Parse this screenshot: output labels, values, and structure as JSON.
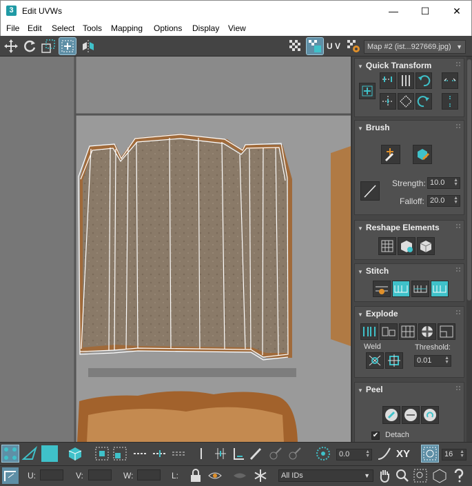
{
  "window": {
    "app_icon_label": "3",
    "title": "Edit UVWs",
    "minimize": "—",
    "maximize": "☐",
    "close": "✕"
  },
  "menu": [
    "File",
    "Edit",
    "Select",
    "Tools",
    "Mapping",
    "Options",
    "Display",
    "View"
  ],
  "toolbar": {
    "uv_label": "U V",
    "map_select": "Map #2 (ist...927669.jpg)"
  },
  "quick_transform": {
    "title": "Quick Transform"
  },
  "brush": {
    "title": "Brush",
    "strength_label": "Strength:",
    "strength_value": "10.0",
    "falloff_label": "Falloff:",
    "falloff_value": "20.0"
  },
  "reshape": {
    "title": "Reshape Elements"
  },
  "stitch": {
    "title": "Stitch"
  },
  "explode": {
    "title": "Explode",
    "weld_label": "Weld",
    "threshold_label": "Threshold:",
    "threshold_value": "0.01"
  },
  "peel": {
    "title": "Peel",
    "detach_label": "Detach",
    "detach_checked": true
  },
  "bottom": {
    "angle_value": "0.0",
    "xy_label": "XY",
    "snap_value": "16",
    "u_label": "U:",
    "v_label": "V:",
    "w_label": "W:",
    "l_label": "L:",
    "ids_select": "All IDs"
  },
  "colors": {
    "accent": "#3fc1c9",
    "selected": "#5f8fa6",
    "panel_bg": "#505050",
    "uv_wire": "#ffffff"
  }
}
